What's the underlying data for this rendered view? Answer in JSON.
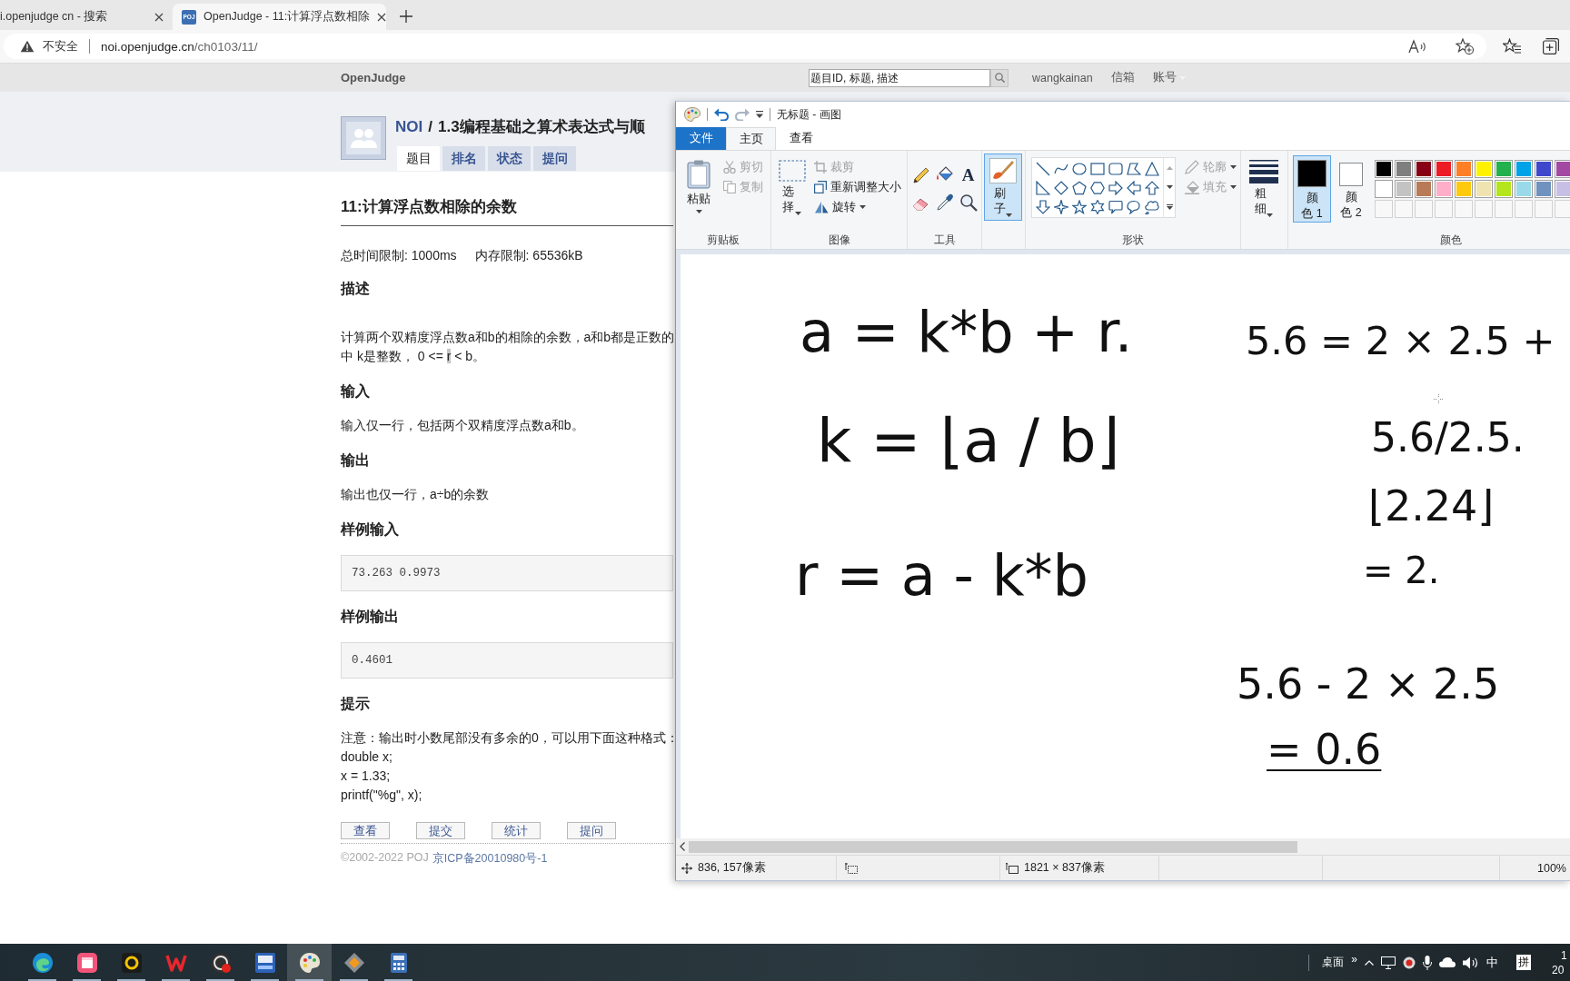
{
  "browser": {
    "tabs": [
      {
        "title": "i.openjudge cn - 搜索",
        "selected": false
      },
      {
        "title": "OpenJudge - 11:计算浮点数相除",
        "favicon": "POJ",
        "selected": true
      }
    ],
    "security": "不安全",
    "url_host": "noi.openjudge.cn",
    "url_path": "/ch0103/11/"
  },
  "site": {
    "logo": "OpenJudge",
    "search": {
      "placeholder": "题目ID, 标题, 描述"
    },
    "links": [
      {
        "label": "wangkainan",
        "kind": "link"
      },
      {
        "label": "信箱",
        "kind": "link"
      },
      {
        "label": "账号",
        "kind": "menu"
      }
    ]
  },
  "problem_header": {
    "group": "NOI",
    "separator": "/",
    "course": "1.3编程基础之算术表达式与顺",
    "tabs": [
      {
        "label": "题目",
        "selected": true
      },
      {
        "label": "排名",
        "selected": false
      },
      {
        "label": "状态",
        "selected": false
      },
      {
        "label": "提问",
        "selected": false
      }
    ]
  },
  "problem": {
    "title": "11:计算浮点数相除的余数",
    "limits": [
      "总时间限制: 1000ms",
      "内存限制: 65536kB"
    ],
    "sections": [
      {
        "heading": "描述",
        "kind": "prose",
        "lines": [
          [
            {
              "text": "计算两个双精度浮点数a和b的相除的余数，a和b都是正数的",
              "highlighted": false
            }
          ],
          [
            {
              "text": "中 k是整数， 0 <= ",
              "highlighted": false
            },
            {
              "text": "r",
              "highlighted": true
            },
            {
              "text": " < b。",
              "highlighted": false
            }
          ]
        ]
      },
      {
        "heading": "输入",
        "kind": "plain",
        "lines": [
          "输入仅一行，包括两个双精度浮点数a和b。"
        ]
      },
      {
        "heading": "输出",
        "kind": "plain",
        "lines": [
          "输出也仅一行，a÷b的余数"
        ]
      },
      {
        "heading": "样例输入",
        "kind": "sample",
        "lines": [
          "73.263 0.9973"
        ]
      },
      {
        "heading": "样例输出",
        "kind": "sample",
        "lines": [
          "0.4601"
        ]
      },
      {
        "heading": "提示",
        "kind": "plain",
        "lines": [
          "注意：输出时小数尾部没有多余的0，可以用下面这种格式：",
          "double x;",
          "x = 1.33;",
          "printf(\"%g\", x);"
        ]
      }
    ],
    "buttons": [
      "查看",
      "提交",
      "统计",
      "提问"
    ],
    "footer": {
      "copyright": "©2002-2022 POJ",
      "icp": "京ICP备20010980号-1"
    }
  },
  "paint": {
    "app_title": "无标题 - 画图",
    "tabs": [
      {
        "label": "文件",
        "kind": "file",
        "selected": false
      },
      {
        "label": "主页",
        "kind": "tab",
        "selected": true
      },
      {
        "label": "查看",
        "kind": "tab",
        "selected": false
      }
    ],
    "clipboard": {
      "label": "剪贴板",
      "paste": "粘贴",
      "cut": {
        "label": "剪切",
        "disabled": true
      },
      "copy": {
        "label": "复制",
        "disabled": true
      }
    },
    "image": {
      "label": "图像",
      "select": "选择",
      "crop": {
        "label": "裁剪",
        "disabled": true
      },
      "resize": {
        "label": "重新调整大小",
        "disabled": false
      },
      "rotate": {
        "label": "旋转",
        "disabled": false
      }
    },
    "tools": {
      "label": "工具",
      "text_glyph": "A"
    },
    "brushes": {
      "label": "刷子",
      "selected": true
    },
    "shapes": {
      "label": "形状",
      "outline": {
        "label": "轮廓",
        "disabled": true
      },
      "fill": {
        "label": "填充",
        "disabled": true
      }
    },
    "size": {
      "label": "粗细"
    },
    "colors": {
      "label": "颜色",
      "color1": {
        "label_lines": [
          "颜",
          "色 1"
        ],
        "color": "#000000",
        "selected": true
      },
      "color2": {
        "label_lines": [
          "颜",
          "色 2"
        ],
        "color": "#ffffff",
        "selected": false
      },
      "palette": [
        {
          "kind": "swatch",
          "color": "#000000"
        },
        {
          "kind": "swatch",
          "color": "#7f7f7f"
        },
        {
          "kind": "swatch",
          "color": "#880015"
        },
        {
          "kind": "swatch",
          "color": "#ed1c24"
        },
        {
          "kind": "swatch",
          "color": "#ff7f27"
        },
        {
          "kind": "swatch",
          "color": "#fff200"
        },
        {
          "kind": "swatch",
          "color": "#22b14c"
        },
        {
          "kind": "swatch",
          "color": "#00a2e8"
        },
        {
          "kind": "swatch",
          "color": "#3f48cc"
        },
        {
          "kind": "swatch",
          "color": "#a349a4"
        },
        {
          "kind": "swatch",
          "color": "#ffffff"
        },
        {
          "kind": "swatch",
          "color": "#c3c3c3"
        },
        {
          "kind": "swatch",
          "color": "#b97a57"
        },
        {
          "kind": "swatch",
          "color": "#ffaec9"
        },
        {
          "kind": "swatch",
          "color": "#ffc90e"
        },
        {
          "kind": "swatch",
          "color": "#efe4b0"
        },
        {
          "kind": "swatch",
          "color": "#b5e61d"
        },
        {
          "kind": "swatch",
          "color": "#99d9ea"
        },
        {
          "kind": "swatch",
          "color": "#7092be"
        },
        {
          "kind": "swatch",
          "color": "#c8bfe7"
        },
        {
          "kind": "blank"
        },
        {
          "kind": "blank"
        },
        {
          "kind": "blank"
        },
        {
          "kind": "blank"
        },
        {
          "kind": "blank"
        },
        {
          "kind": "blank"
        },
        {
          "kind": "blank"
        },
        {
          "kind": "blank"
        },
        {
          "kind": "blank"
        },
        {
          "kind": "blank"
        }
      ]
    },
    "canvas": {
      "notes": [
        {
          "text": "a = k*b + r.",
          "underlined": false
        },
        {
          "text": "k = ⌊a / b⌋",
          "underlined": false
        },
        {
          "text": "r = a - k*b",
          "underlined": false
        },
        {
          "text": "5.6 = 2 × 2.5 +",
          "underlined": false
        },
        {
          "text": "5.6/2.5.",
          "underlined": false
        },
        {
          "text": "⌊2.24⌋",
          "underlined": false
        },
        {
          "text": "= 2.",
          "underlined": false
        },
        {
          "text": "5.6 - 2 × 2.5",
          "underlined": false
        },
        {
          "text": "= 0.6",
          "underlined": true
        }
      ]
    },
    "status": {
      "position": "836, 157像素",
      "size": "1821 × 837像素",
      "zoom": "100%"
    }
  },
  "taskbar": {
    "apps": [
      {
        "kind": "browser",
        "running": true,
        "active": false
      },
      {
        "kind": "calendar",
        "running": true,
        "active": false
      },
      {
        "kind": "ring",
        "running": true,
        "active": false
      },
      {
        "kind": "office",
        "running": true,
        "active": false
      },
      {
        "kind": "recorder",
        "running": true,
        "active": false
      },
      {
        "kind": "ide",
        "running": true,
        "active": false
      },
      {
        "kind": "paint",
        "running": true,
        "active": true
      },
      {
        "kind": "tool",
        "running": true,
        "active": false
      },
      {
        "kind": "calculator",
        "running": true,
        "active": false
      }
    ],
    "desktop": "桌面",
    "overflow": "»",
    "ime": "中",
    "ime_mode": "拼",
    "time": "1",
    "date": "20"
  }
}
